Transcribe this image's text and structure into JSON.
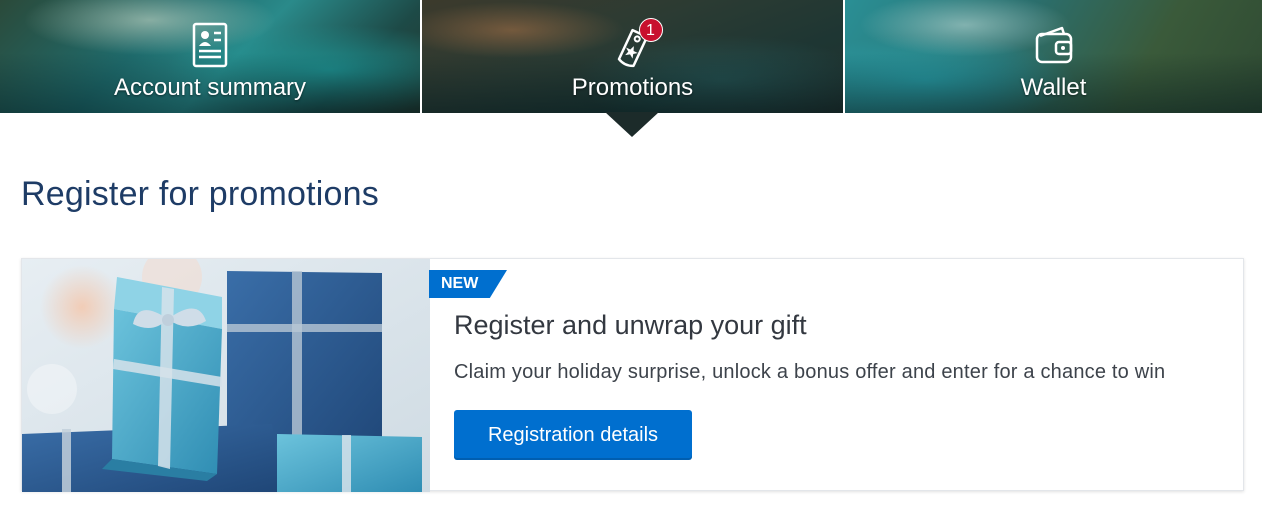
{
  "tabs": [
    {
      "label": "Account summary",
      "icon": "account-card-icon"
    },
    {
      "label": "Promotions",
      "icon": "promotion-tag-icon",
      "badge": "1",
      "selected": true
    },
    {
      "label": "Wallet",
      "icon": "wallet-icon"
    }
  ],
  "page": {
    "title": "Register for promotions"
  },
  "promo_card": {
    "tag": "NEW",
    "title": "Register and unwrap your gift",
    "description": "Claim your holiday surprise, unlock a bonus offer and enter for a chance to win",
    "button_label": "Registration details",
    "image": "gift-boxes-image"
  },
  "colors": {
    "brand_blue": "#006fcf",
    "heading_blue": "#1e3c66",
    "badge_red": "#c8102e"
  }
}
